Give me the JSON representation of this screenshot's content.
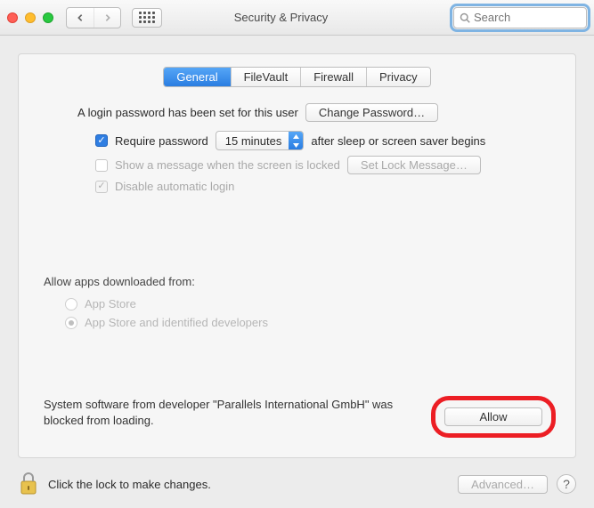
{
  "window": {
    "title": "Security & Privacy"
  },
  "search": {
    "placeholder": "Search"
  },
  "tabs": [
    "General",
    "FileVault",
    "Firewall",
    "Privacy"
  ],
  "general": {
    "login_password_msg": "A login password has been set for this user",
    "change_password_label": "Change Password…",
    "require_pw": {
      "checked": true,
      "label_before": "Require password",
      "value": "15 minutes",
      "label_after": "after sleep or screen saver begins"
    },
    "lock_message": {
      "checked": false,
      "label": "Show a message when the screen is locked",
      "button": "Set Lock Message…",
      "enabled": false
    },
    "disable_auto_login": {
      "checked": true,
      "enabled": false,
      "label": "Disable automatic login"
    }
  },
  "gatekeeper": {
    "title": "Allow apps downloaded from:",
    "options": [
      "App Store",
      "App Store and identified developers"
    ],
    "selected_index": 1,
    "enabled": false
  },
  "blocked_software": {
    "text": "System software from developer \"Parallels International GmbH\" was blocked from loading.",
    "button": "Allow"
  },
  "footer": {
    "lock_text": "Click the lock to make changes.",
    "advanced_label": "Advanced…"
  }
}
